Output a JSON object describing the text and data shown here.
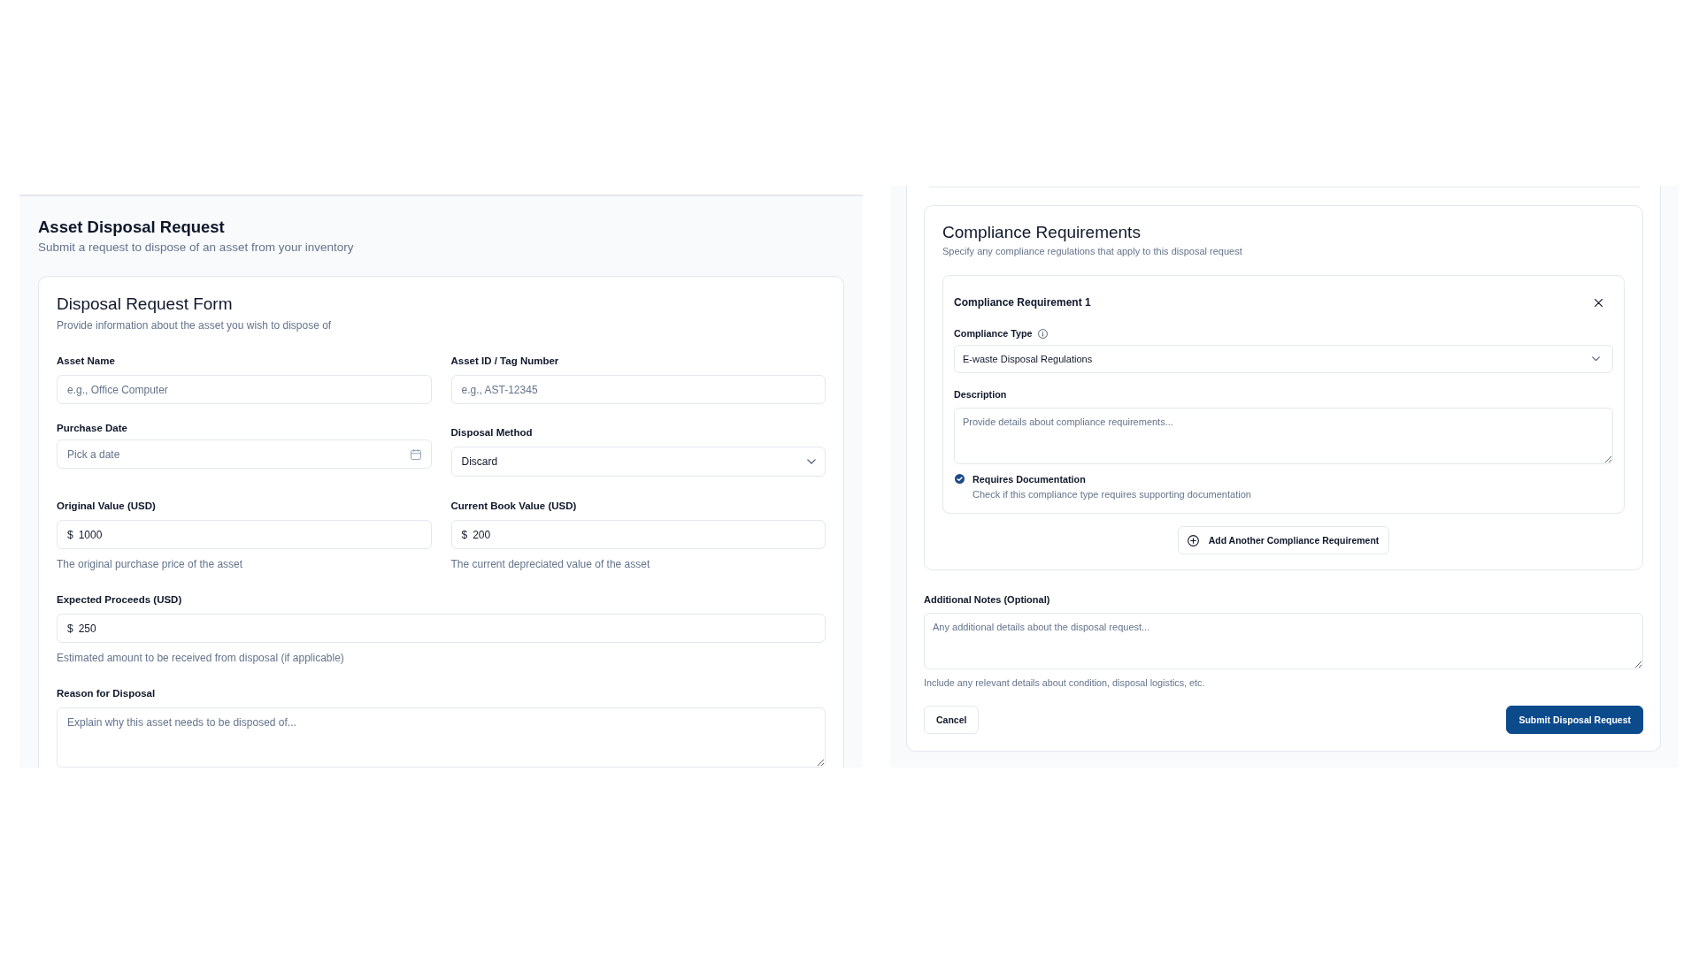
{
  "left_panel": {
    "title": "Asset Disposal Request",
    "subtitle": "Submit a request to dispose of an asset from your inventory",
    "form_card": {
      "title": "Disposal Request Form",
      "subtitle": "Provide information about the asset you wish to dispose of",
      "rows": [
        [
          {
            "kind": "text",
            "label": "Asset Name",
            "placeholder": "e.g., Office Computer"
          },
          {
            "kind": "text",
            "label": "Asset ID / Tag Number",
            "placeholder": "e.g., AST-12345"
          }
        ],
        [
          {
            "kind": "date",
            "label": "Purchase Date",
            "placeholder": "Pick a date"
          },
          {
            "kind": "select",
            "label": "Disposal Method",
            "value": "Discard"
          }
        ],
        [
          {
            "kind": "currency",
            "label": "Original Value (USD)",
            "prefix": "$",
            "value": "1000",
            "help": "The original purchase price of the asset"
          },
          {
            "kind": "currency",
            "label": "Current Book Value (USD)",
            "prefix": "$",
            "value": "200",
            "help": "The current depreciated value of the asset"
          }
        ],
        [
          {
            "kind": "currency",
            "label": "Expected Proceeds (USD)",
            "prefix": "$",
            "value": "250",
            "help": "Estimated amount to be received from disposal (if applicable)"
          }
        ],
        [
          {
            "kind": "textarea",
            "label": "Reason for Disposal",
            "placeholder": "Explain why this asset needs to be disposed of..."
          }
        ]
      ]
    }
  },
  "right_panel": {
    "compliance": {
      "title": "Compliance Requirements",
      "subtitle": "Specify any compliance regulations that apply to this disposal request",
      "requirements": [
        {
          "title": "Compliance Requirement 1",
          "type_field": {
            "label": "Compliance Type",
            "value": "E-waste Disposal Regulations"
          },
          "description_field": {
            "label": "Description",
            "placeholder": "Provide details about compliance requirements..."
          },
          "documentation": {
            "label": "Requires Documentation",
            "help": "Check if this compliance type requires supporting documentation",
            "checked": true
          }
        }
      ],
      "add_button": "Add Another Compliance Requirement"
    },
    "notes": {
      "label": "Additional Notes (Optional)",
      "placeholder": "Any additional details about the disposal request...",
      "help": "Include any relevant details about condition, disposal logistics, etc."
    },
    "buttons": [
      {
        "kind": "secondary",
        "label": "Cancel"
      },
      {
        "kind": "primary",
        "label": "Submit Disposal Request"
      }
    ]
  }
}
